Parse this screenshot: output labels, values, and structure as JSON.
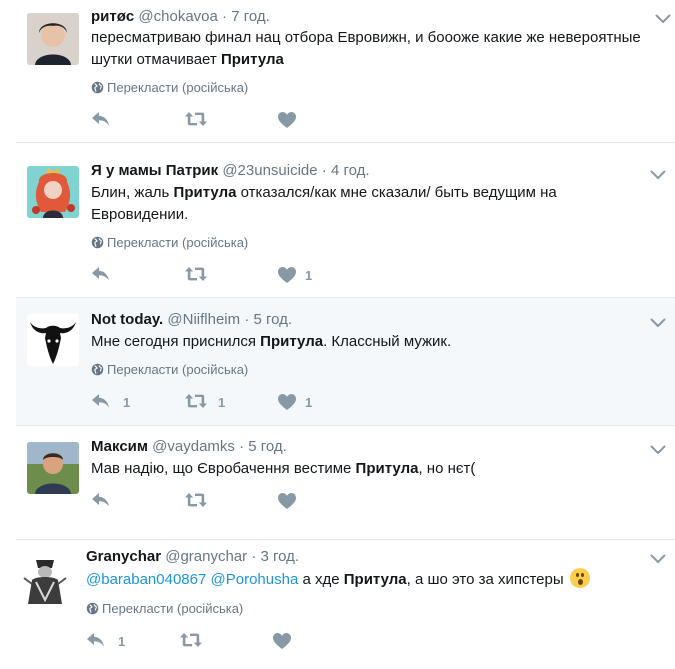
{
  "translate_label": "Перекласти (російська)",
  "colors": {
    "link": "#1b95e0",
    "muted": "#657786",
    "icon": "#8899a6",
    "highlight_bg": "#f5f8fa"
  },
  "icons": {
    "reply": "reply-icon",
    "retweet": "retweet-icon",
    "like": "heart-icon",
    "more": "chevron-down-icon",
    "translate": "globe-icon"
  },
  "tweets": [
    {
      "name": "ритøс",
      "handle": "@chokavoa",
      "dot": "·",
      "time": "7 год.",
      "text_before": "пересматриваю финал нац отбора Евровижн, и боооже какие же невероятные шутки отмачивает ",
      "text_bold": "Притула",
      "text_after": "",
      "reply_count": "",
      "retweet_count": "",
      "like_count": ""
    },
    {
      "name": "Я у мамы Патрик",
      "handle": "@23unsuicide",
      "dot": "·",
      "time": "4 год.",
      "text_before": "Блин, жаль ",
      "text_bold": "Притула",
      "text_after": " отказался/как мне сказали/ быть ведущим на Евровидении.",
      "reply_count": "",
      "retweet_count": "",
      "like_count": "1"
    },
    {
      "name": "Not today.",
      "handle": "@Niiflheim",
      "dot": "·",
      "time": "5 год.",
      "text_before": "Мне сегодня приснился ",
      "text_bold": "Притула",
      "text_after": ". Классный мужик.",
      "reply_count": "1",
      "retweet_count": "1",
      "like_count": "1"
    },
    {
      "name": "Максим",
      "handle": "@vaydamks",
      "dot": "·",
      "time": "5 год.",
      "text_before": "Мав надію, що Євробачення вестиме ",
      "text_bold": "Притула",
      "text_after": ", но нєт(",
      "reply_count": "",
      "retweet_count": "",
      "like_count": ""
    },
    {
      "name": "Granychar",
      "handle": "@granychar",
      "dot": "·",
      "time": "3 год.",
      "mention1": "@baraban040867",
      "mention2": "@Porohusha",
      "text_before": " а хде ",
      "text_bold": "Притула",
      "text_after": ", а шо это за хипстеры",
      "reply_count": "1",
      "retweet_count": "",
      "like_count": ""
    }
  ]
}
